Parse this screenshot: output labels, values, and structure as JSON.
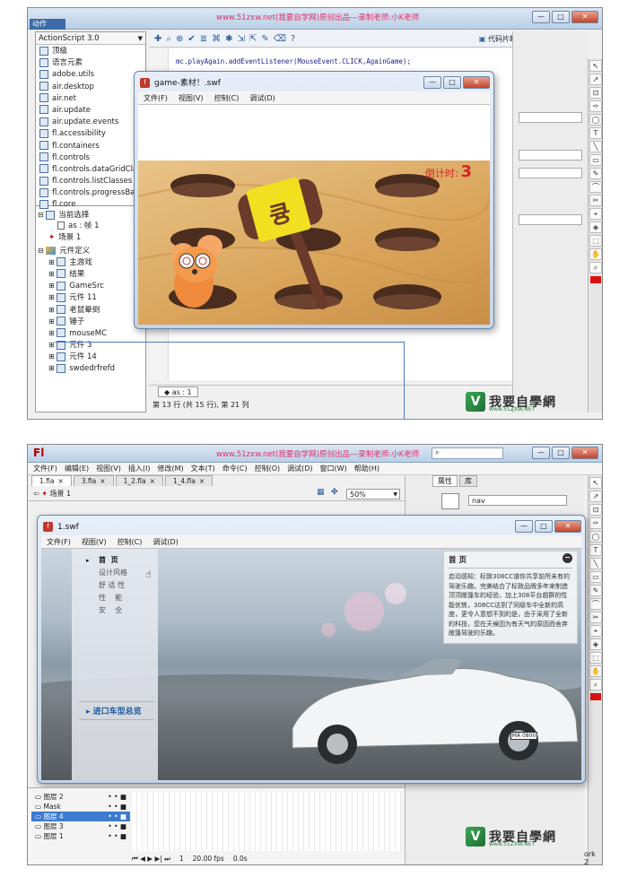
{
  "watermark_top": "www.51zxw.net(我要自学网)原创出品---录制老师:小K老师",
  "logo": {
    "name": "我要自學網",
    "url_text": "www.51ZXW.NET"
  },
  "shot1": {
    "actions_tab": "动作",
    "as_version": "ActionScript 3.0",
    "packages": [
      "顶级",
      "语言元素",
      "adobe.utils",
      "air.desktop",
      "air.net",
      "air.update",
      "air.update.events",
      "fl.accessibility",
      "fl.containers",
      "fl.controls",
      "fl.controls.dataGridCla...",
      "fl.controls.listClasses",
      "fl.controls.progressBar...",
      "fl.core"
    ],
    "tree": {
      "current_selection": "当前选择",
      "current_item": "as : 帧 1",
      "scene": "场景 1",
      "symbols": "元件定义",
      "symbol_items": [
        "主游戏",
        "结果",
        "GameSrc",
        "元件 11",
        "老鼠晕倒",
        "锤子",
        "mouseMC",
        "元件 3",
        "元件 14",
        "swdedrfrefd"
      ]
    },
    "code_snippet_label": "代码片断",
    "code_line": "mc.playAgain.addEventListener(MouseEvent.CLICK,AgainGame);",
    "as_tab": "as : 1",
    "status": "第 13 行 (共 15 行), 第 21 列",
    "swf_title": "game-素材！.swf",
    "swf_menu": [
      "文件(F)",
      "视图(V)",
      "控制(C)",
      "调试(D)"
    ],
    "countdown_label": "倒计时:",
    "countdown_value": "3",
    "hammer_text": "큥"
  },
  "shot2": {
    "app_logo": "Fl",
    "menu": [
      "文件(F)",
      "编辑(E)",
      "视图(V)",
      "插入(I)",
      "修改(M)",
      "文本(T)",
      "命令(C)",
      "控制(O)",
      "调试(D)",
      "窗口(W)",
      "帮助(H)"
    ],
    "tabs": [
      "1.fla",
      "3.fla",
      "1_2.fla",
      "1_4.fla"
    ],
    "scene": "场景 1",
    "zoom": "50%",
    "panel_tabs": [
      "属性",
      "库"
    ],
    "library_search": "nav",
    "swf_title": "1.swf",
    "swf_menu": [
      "文件(F)",
      "视图(V)",
      "控制(C)",
      "调试(D)"
    ],
    "nav_items": [
      "首  页",
      "设计风格",
      "舒 适 性",
      "性    能",
      "安    全"
    ],
    "nav_bottom": "进口车型总览",
    "info_title": "首  页",
    "info_text": "启动感知：标致308CC谱你共享前所未有的驾驶乐趣。完美结合了标致品牌多年来制造顶顶敞篷车的经验，加上308平台超群的性能优势，308CC达到了同级车中全新的高度，更令人意想不到的是，由于采用了全新的科技，您在天候因为有天气的原因而舍弃敞篷驾驶的乐趣。",
    "plate": "MA 0800",
    "layers": [
      "图层 2",
      "Mask",
      "图层 4",
      "图层 3",
      "图层 1"
    ],
    "timeline_fps": "20.00 fps",
    "timeline_time": "0.0s",
    "timeline_frame": "1",
    "work_label": "ork 2"
  }
}
